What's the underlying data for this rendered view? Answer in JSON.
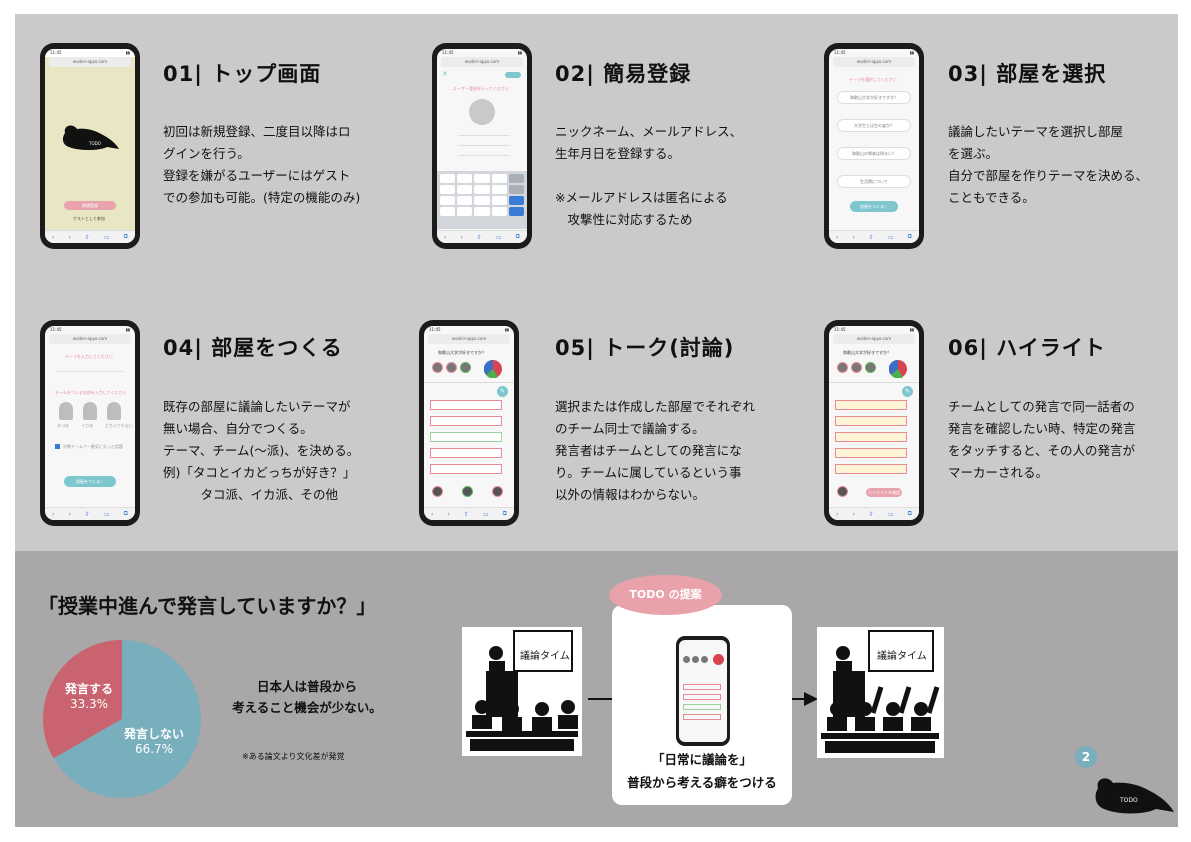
{
  "app_ui": {
    "status_time": "11:45",
    "url": "wodeir-appo.com",
    "todo_logo": "TODO",
    "guest_btn": "新規登録",
    "guest_link": "ゲストとして参加",
    "reg_header": "ユーザー登録を行ってください",
    "room_header": "テーマを選択してください",
    "rooms": [
      "和歌山大学が好きですか？",
      "大学生とは生の姿か？",
      "和歌山の将来は明るい？",
      "生活費について"
    ],
    "make_room_btn": "部屋をつくる！",
    "create_theme_label": "テーマを入力してください",
    "create_team_label": "チームをつくる名前を入力してください",
    "teams": [
      "タコ派",
      "イカ派",
      "どちらでもない"
    ],
    "create_check": "対戦チームで一番気になった話題",
    "create_btn": "部屋をつくる！",
    "talk_question": "和歌山大学が好きですか？",
    "highlight_btn": "ハイライトを確認"
  },
  "sections": [
    {
      "title": "01| トップ画面",
      "body": "初回は新規登録、二度目以降はロ\nグインを行う。\n登録を嫌がるユーザーにはゲスト\nでの参加も可能。(特定の機能のみ)"
    },
    {
      "title": "02| 簡易登録",
      "body": "ニックネーム、メールアドレス、\n生年月日を登録する。\n\n※メールアドレスは匿名による\n　攻撃性に対応するため"
    },
    {
      "title": "03| 部屋を選択",
      "body": "議論したいテーマを選択し部屋\nを選ぶ。\n自分で部屋を作りテーマを決める、\nこともできる。"
    },
    {
      "title": "04| 部屋をつくる",
      "body": "既存の部屋に議論したいテーマが\n無い場合、自分でつくる。\nテーマ、チーム(〜派)、を決める。\n例)「タコとイカどっちが好き？」\n　　　タコ派、イカ派、その他"
    },
    {
      "title": "05| トーク(討論)",
      "body": "選択または作成した部屋でそれぞれ\nのチーム同士で議論する。\n発言者はチームとしての発言にな\nり。チームに属しているという事\n以外の情報はわからない。"
    },
    {
      "title": "06| ハイライト",
      "body": "チームとしての発言で同一話者の\n発言を確認したい時、特定の発言\nをタッチすると、その人の発言が\nマーカーされる。"
    }
  ],
  "survey": {
    "title": "「授業中進んで発言していますか？」",
    "note": "日本人は普段から\n考えること機会が少ない。",
    "source": "※ある論文より文化差が発覚"
  },
  "chart_data": {
    "type": "pie",
    "title": "「授業中進んで発言していますか？」",
    "slices": [
      {
        "label": "発言する",
        "value": 33.3,
        "display": "33.3%",
        "color": "#c9636f"
      },
      {
        "label": "発言しない",
        "value": 66.7,
        "display": "66.7%",
        "color": "#79aebc"
      }
    ]
  },
  "proposal": {
    "badge": "TODO の提案",
    "text": "「日常に議論を」\n普段から考える癖をつける",
    "board_label": "議論タイム"
  },
  "page": {
    "number": "2",
    "logo": "TODO"
  },
  "colors": {
    "top_panel": "#cbc9ca",
    "bottom_panel": "#a9a7a8",
    "pink": "#e8a3ad",
    "teal": "#7fc7cf",
    "pie_red": "#c9636f",
    "pie_blue": "#79aebc",
    "page_badge": "#79aebc"
  }
}
